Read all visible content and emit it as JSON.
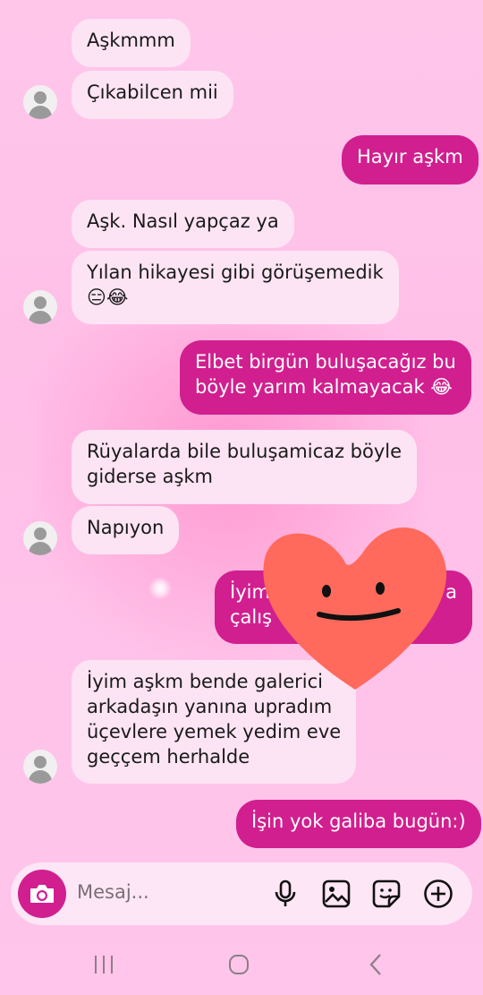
{
  "messages": [
    {
      "dir": "in",
      "text": "Aşkmmm"
    },
    {
      "dir": "in",
      "text": "Çıkabilcen mii"
    },
    {
      "dir": "out",
      "text": "Hayır aşkm"
    },
    {
      "dir": "in",
      "text": "Aşk. Nasıl yapçaz ya"
    },
    {
      "dir": "in",
      "line1": "Yılan hikayesi gibi görüşemedik",
      "line2": "😑😂"
    },
    {
      "dir": "out",
      "line1": "Elbet birgün buluşacağız bu",
      "line2": "böyle yarım kalmayacak 😂"
    },
    {
      "dir": "in",
      "line1": "Rüyalarda bile buluşamicaz böyle",
      "line2": "giderse aşkm"
    },
    {
      "dir": "in",
      "text": "Napıyon"
    },
    {
      "dir": "out",
      "line1": "İyim",
      "line1_end": "a",
      "line2": "çalış"
    },
    {
      "dir": "in",
      "line1": "İyim aşkm bende galerici",
      "line2": "arkadaşın yanına upradım",
      "line3": "üçevlere yemek yedim eve",
      "line4": "geççem herhalde"
    },
    {
      "dir": "out",
      "text": "İşin yok galiba bugün:)"
    }
  ],
  "composer": {
    "placeholder": "Mesaj...",
    "icons": [
      "camera-icon",
      "microphone-icon",
      "image-icon",
      "sticker-icon",
      "plus-icon"
    ]
  },
  "colors": {
    "outgoing": "#d11f8f",
    "incoming": "#fde4f4",
    "background": "#ffc1e8",
    "sticker": "#ff6a5c"
  },
  "navbar": {
    "icons": [
      "recents-icon",
      "home-icon",
      "back-icon"
    ]
  }
}
